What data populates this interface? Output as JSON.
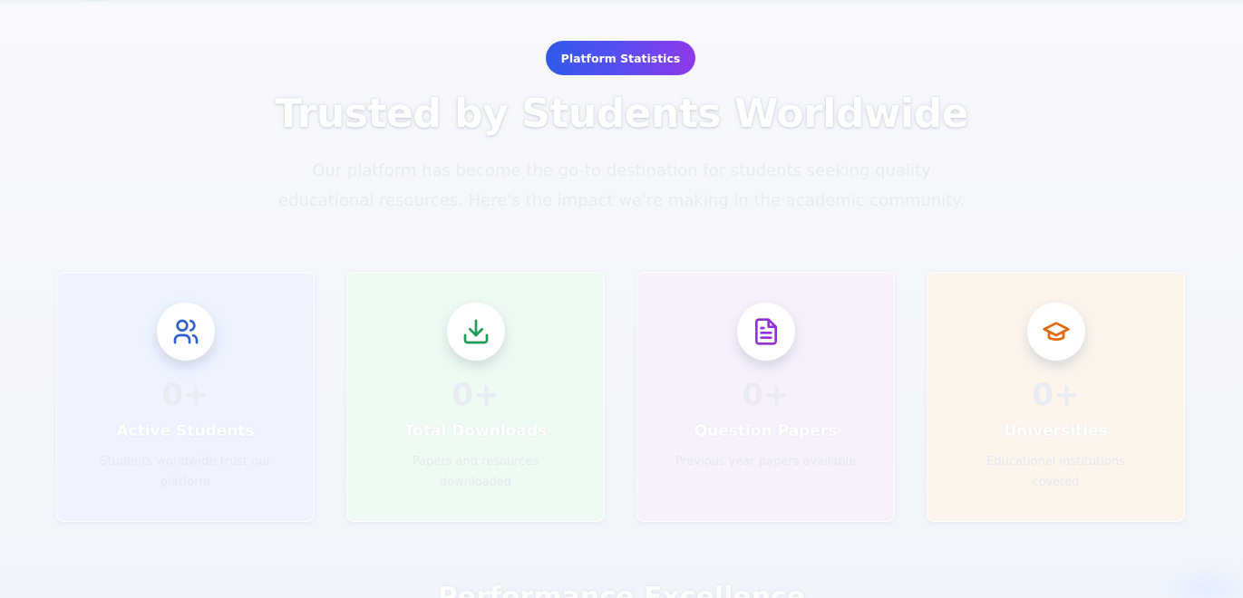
{
  "badge": {
    "label": "Platform Statistics"
  },
  "header": {
    "title": "Trusted by Students Worldwide",
    "subtitle": "Our platform has become the go-to destination for students seeking quality educational resources. Here's the impact we're making in the academic community."
  },
  "stats": [
    {
      "icon": "users-icon",
      "value": "0+",
      "label": "Active Students",
      "description": "Students worldwide trust our platform",
      "color": "#2f5bd3"
    },
    {
      "icon": "download-icon",
      "value": "0+",
      "label": "Total Downloads",
      "description": "Papers and resources downloaded",
      "color": "#1f9a55"
    },
    {
      "icon": "file-text-icon",
      "value": "0+",
      "label": "Question Papers",
      "description": "Previous year papers available",
      "color": "#9032d6"
    },
    {
      "icon": "graduation-cap-icon",
      "value": "0+",
      "label": "Universities",
      "description": "Educational institutions covered",
      "color": "#e0680e"
    }
  ],
  "next_section": {
    "title": "Performance Excellence"
  },
  "colors": {
    "badge_gradient_start": "#2f59e9",
    "badge_gradient_end": "#8d3ae9",
    "card_blue": "#eef3ff",
    "card_green": "#eefbf3",
    "card_purple": "#f7f1fd",
    "card_orange": "#fdf5ec"
  }
}
